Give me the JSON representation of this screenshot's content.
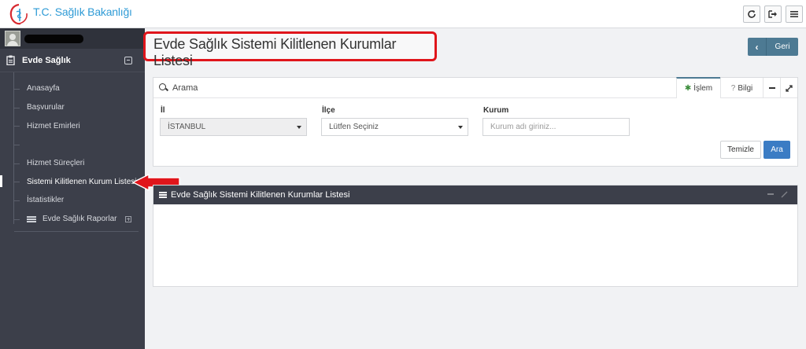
{
  "topbar": {
    "logo_text": "T.C. Sağlık Bakanlığı",
    "icons": [
      "refresh-icon",
      "logout-icon",
      "menu-icon"
    ]
  },
  "sidebar": {
    "section_label": "Evde Sağlık",
    "items": [
      {
        "label": "Anasayfa"
      },
      {
        "label": "Başvurular"
      },
      {
        "label": "Hizmet Emirleri"
      },
      {
        "label": ""
      },
      {
        "label": "Hizmet Süreçleri"
      },
      {
        "label": "Sistemi Kilitlenen Kurum Listesi",
        "active": true
      },
      {
        "label": "İstatistikler"
      },
      {
        "label": "Evde Sağlık Raporlar"
      }
    ]
  },
  "header": {
    "title": "Evde Sağlık Sistemi Kilitlenen Kurumlar Listesi",
    "back_label": "Geri"
  },
  "search_panel": {
    "title": "Arama",
    "tabs": {
      "islem": "İşlem",
      "bilgi": "Bilgi"
    },
    "fields": {
      "il_label": "İl",
      "il_value": "İSTANBUL",
      "ilce_label": "İlçe",
      "ilce_value": "Lütfen Seçiniz",
      "kurum_label": "Kurum",
      "kurum_placeholder": "Kurum adı giriniz..."
    },
    "clear_label": "Temizle",
    "search_label": "Ara"
  },
  "list_panel": {
    "title": "Evde Sağlık Sistemi Kilitlenen Kurumlar Listesi"
  },
  "colors": {
    "sidebar_bg": "#3c3f4a",
    "accent": "#4d7a93",
    "primary_button": "#3b7cc4",
    "highlight": "#e0151b"
  }
}
